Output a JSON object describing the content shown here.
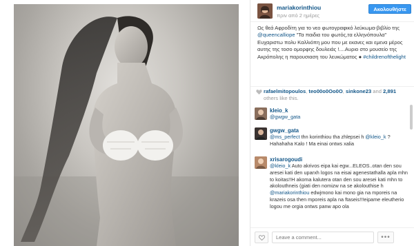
{
  "post": {
    "username": "mariakorinthiou",
    "time": "πριν από 2 ημέρες",
    "follow_label": "Ακολουθήστε",
    "caption_parts": [
      "Ως θεά Αφροδίτη για το νεο φωτογραφικό λεύκωμα-βιβλίο της ",
      "@queencalliope",
      " \"Τα παιδια του φωτός,τα ελληνόπουλα\" Ευχαριστω πολυ Καλλιόπη μου που με εκανες και εμενα μέρος αυτης της τοσο ομορφης δουλειάς !....Αυριο στο μουσείο της Ακρόπολης η παρουσιαση του λευκώματος ",
      "●",
      " #childrenofthelight"
    ]
  },
  "likes": {
    "users": [
      "rafaelmitopoulos",
      "teo00o0Oo0O",
      "sinkone23"
    ],
    "separator": ", ",
    "and": " and ",
    "count": "2,891",
    "suffix": " others like this."
  },
  "comments": [
    {
      "user": "kleio_k",
      "text_parts": [
        "@gwgw_gata"
      ]
    },
    {
      "user": "gwgw_gata",
      "text_parts": [
        "@ms_perfect",
        " thn korinthiou tha zhlepsei h ",
        "@kleio_k",
        " ? Hahahaha Kalo ! Ma einai ontws xalia"
      ]
    },
    {
      "user": "xrisarogoudi",
      "text_parts": [
        "@kleio_k",
        " Auto akrivos eipa kai egw...ELEOS..otan den sou aresei kati den uparxh logos na eisai agenestathalla apla mhn to koitas!!H akoma kalutera otan den sou aresei kati mhn to akolouthneis (giati den nomizw na se akolouthise h ",
        "@mariakorinthiou",
        " edwjmono kai mono gia na mporeis na krazeis osa then mporeis apla na ftaseis!!!eipame eleutherio logou me orgia ontws panw apo ola"
      ]
    }
  ],
  "footer": {
    "comment_placeholder": "Leave a comment...",
    "more_label": "•••"
  },
  "icons": {
    "heart": "heart-icon",
    "like": "heart-outline-icon",
    "more": "ellipsis-icon"
  },
  "colors": {
    "link": "#125688",
    "follow_button": "#3897f0",
    "muted": "#999999"
  }
}
